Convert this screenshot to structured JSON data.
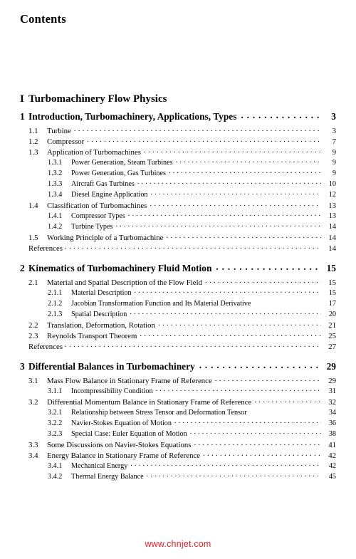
{
  "document": {
    "heading": "Contents",
    "watermark": "www.chnjet.com",
    "watermark_color": "#ee1c24",
    "text_color": "#000000",
    "background_color": "#ffffff"
  },
  "toc": {
    "entries": [
      {
        "level": "part",
        "number": "I",
        "title": "Turbomachinery Flow Physics",
        "page": "",
        "leaders": false
      },
      {
        "level": "chapter",
        "number": "1",
        "title": "Introduction, Turbomachinery, Applications, Types",
        "page": "3",
        "leaders": true
      },
      {
        "level": "sec",
        "number": "1.1",
        "title": "Turbine",
        "page": "3",
        "leaders": true
      },
      {
        "level": "sec",
        "number": "1.2",
        "title": "Compressor",
        "page": "7",
        "leaders": true
      },
      {
        "level": "sec",
        "number": "1.3",
        "title": "Application of Turbomachines",
        "page": "9",
        "leaders": true
      },
      {
        "level": "sub",
        "number": "1.3.1",
        "title": "Power Generation, Steam Turbines",
        "page": "9",
        "leaders": true
      },
      {
        "level": "sub",
        "number": "1.3.2",
        "title": "Power Generation, Gas Turbines",
        "page": "9",
        "leaders": true
      },
      {
        "level": "sub",
        "number": "1.3.3",
        "title": "Aircraft Gas Turbines",
        "page": "10",
        "leaders": true
      },
      {
        "level": "sub",
        "number": "1.3.4",
        "title": "Diesel Engine Application",
        "page": "12",
        "leaders": true
      },
      {
        "level": "sec",
        "number": "1.4",
        "title": "Classification of Turbomachines",
        "page": "13",
        "leaders": true
      },
      {
        "level": "sub",
        "number": "1.4.1",
        "title": "Compressor Types",
        "page": "13",
        "leaders": true
      },
      {
        "level": "sub",
        "number": "1.4.2",
        "title": "Turbine Types",
        "page": "14",
        "leaders": true
      },
      {
        "level": "sec",
        "number": "1.5",
        "title": "Working Principle of a Turbomachine",
        "page": "14",
        "leaders": true
      },
      {
        "level": "refs",
        "number": "",
        "title": "References",
        "page": "14",
        "leaders": true
      },
      {
        "level": "chapter",
        "number": "2",
        "title": "Kinematics of Turbomachinery Fluid Motion",
        "page": "15",
        "leaders": true
      },
      {
        "level": "sec",
        "number": "2.1",
        "title": "Material and Spatial Description of the Flow Field",
        "page": "15",
        "leaders": true
      },
      {
        "level": "sub",
        "number": "2.1.1",
        "title": "Material Description",
        "page": "15",
        "leaders": true
      },
      {
        "level": "sub",
        "number": "2.1.2",
        "title": "Jacobian Transformation Function and Its Material Derivative",
        "page": "17",
        "leaders": false
      },
      {
        "level": "sub",
        "number": "2.1.3",
        "title": "Spatial Description",
        "page": "20",
        "leaders": true
      },
      {
        "level": "sec",
        "number": "2.2",
        "title": "Translation, Deformation, Rotation",
        "page": "21",
        "leaders": true
      },
      {
        "level": "sec",
        "number": "2.3",
        "title": "Reynolds Transport Theorem",
        "page": "25",
        "leaders": true
      },
      {
        "level": "refs",
        "number": "",
        "title": "References",
        "page": "27",
        "leaders": true
      },
      {
        "level": "chapter",
        "number": "3",
        "title": "Differential Balances in Turbomachinery",
        "page": "29",
        "leaders": true
      },
      {
        "level": "sec",
        "number": "3.1",
        "title": "Mass Flow Balance in Stationary Frame of Reference",
        "page": "29",
        "leaders": true
      },
      {
        "level": "sub",
        "number": "3.1.1",
        "title": "Incompressibility Condition",
        "page": "31",
        "leaders": true
      },
      {
        "level": "sec",
        "number": "3.2",
        "title": "Differential Momentum Balance in Stationary Frame of Reference",
        "page": "32",
        "leaders": true
      },
      {
        "level": "sub",
        "number": "3.2.1",
        "title": "Relationship between Stress Tensor and Deformation Tensor",
        "page": "34",
        "leaders": false
      },
      {
        "level": "sub",
        "number": "3.2.2",
        "title": "Navier-Stokes Equation of Motion",
        "page": "36",
        "leaders": true
      },
      {
        "level": "sub",
        "number": "3.2.3",
        "title": "Special Case: Euler Equation of Motion",
        "page": "38",
        "leaders": true
      },
      {
        "level": "sec",
        "number": "3.3",
        "title": "Some Discussions on Navier-Stokes Equations",
        "page": "41",
        "leaders": true
      },
      {
        "level": "sec",
        "number": "3.4",
        "title": "Energy Balance in Stationary Frame of Reference",
        "page": "42",
        "leaders": true
      },
      {
        "level": "sub",
        "number": "3.4.1",
        "title": "Mechanical Energy",
        "page": "42",
        "leaders": true
      },
      {
        "level": "sub",
        "number": "3.4.2",
        "title": "Thermal Energy Balance",
        "page": "45",
        "leaders": true
      }
    ]
  }
}
